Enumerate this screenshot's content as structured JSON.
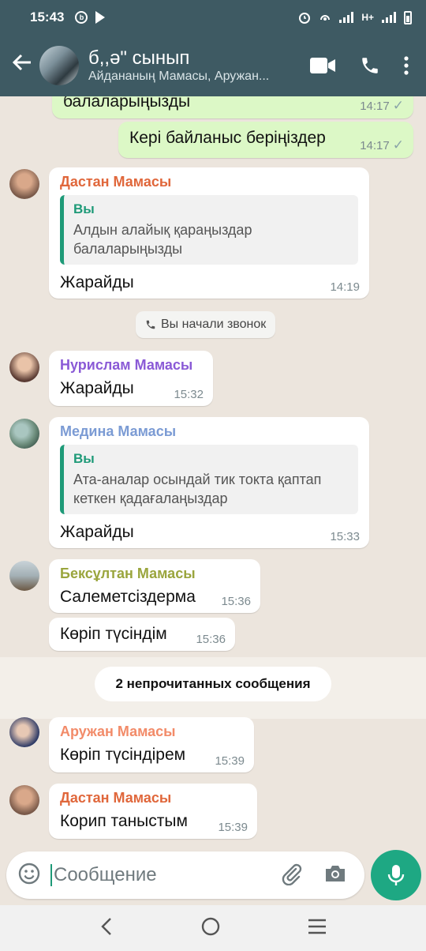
{
  "status_bar": {
    "time": "15:43",
    "network_label": "H+",
    "icons": [
      "b-circle-icon",
      "play-store-icon",
      "alarm-icon",
      "hotspot-icon",
      "signal-icon",
      "signal-icon",
      "battery-icon"
    ]
  },
  "header": {
    "title": "б,,ә\" сынып",
    "members": "Айдананың Мамасы, Аружан...",
    "icons": [
      "back-arrow-icon",
      "video-call-icon",
      "phone-icon",
      "more-vert-icon"
    ]
  },
  "messages": [
    {
      "kind": "outgoing",
      "text": "балаларыңызды",
      "time": "14:17",
      "status": "read"
    },
    {
      "kind": "outgoing",
      "text": "Кері байланыс беріңіздер",
      "time": "14:17",
      "status": "read"
    },
    {
      "kind": "incoming",
      "sender": "Дастан Мамасы",
      "sender_color": "#e0673b",
      "quote_author": "Вы",
      "quote_text": "Алдын алайық қараңыздар балаларыңызды",
      "text": "Жарайды",
      "time": "14:19"
    },
    {
      "kind": "system",
      "text": "Вы начали звонок"
    },
    {
      "kind": "incoming",
      "sender": "Нурислам Мамасы",
      "sender_color": "#8a5ad6",
      "text": "Жарайды",
      "time": "15:32"
    },
    {
      "kind": "incoming",
      "sender": "Медина Мамасы",
      "sender_color": "#7b9bd4",
      "quote_author": "Вы",
      "quote_text": "Ата-аналар осындай тик токта қаптап кеткен қадағалаңыздар",
      "text": "Жарайды",
      "time": "15:33"
    },
    {
      "kind": "incoming",
      "sender": "Бексұлтан Мамасы",
      "sender_color": "#9aa53d",
      "text": "Салеметсіздерма",
      "time": "15:36"
    },
    {
      "kind": "incoming",
      "text": "Көріп түсіндім",
      "time": "15:36"
    },
    {
      "kind": "unread",
      "text": "2 непрочитанных сообщения"
    },
    {
      "kind": "incoming",
      "sender": "Аружан Мамасы",
      "sender_color": "#f28b69",
      "text": "Көріп түсіндірем",
      "time": "15:39"
    },
    {
      "kind": "incoming",
      "sender": "Дастан Мамасы",
      "sender_color": "#e0673b",
      "text": "Корип таныстым",
      "time": "15:39"
    }
  ],
  "composer": {
    "placeholder": "Сообщение",
    "icons": [
      "emoji-icon",
      "attach-icon",
      "camera-icon",
      "mic-icon"
    ]
  },
  "nav": {
    "icons": [
      "nav-back-icon",
      "nav-home-icon",
      "nav-recents-icon"
    ]
  },
  "colors": {
    "header_bg": "#3e5a63",
    "accent": "#1ea883",
    "outgoing_bubble": "#dcf8c6",
    "chat_bg": "#ece5dd"
  }
}
